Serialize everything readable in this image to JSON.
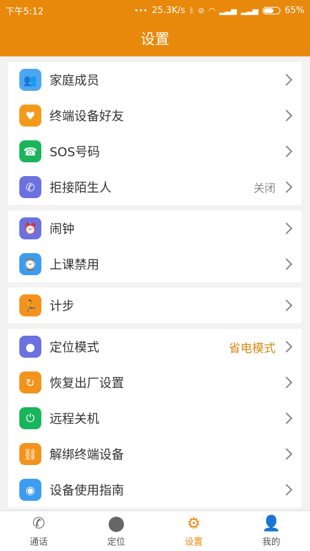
{
  "status_bar": {
    "time": "下午5:12",
    "network_speed": "25.3K/s",
    "battery": "65%",
    "battery_level": 0.65
  },
  "header": {
    "title": "设置"
  },
  "groups": [
    {
      "items": [
        {
          "label": "家庭成员",
          "icon": "family-icon",
          "color": "#4da6f2",
          "value": ""
        },
        {
          "label": "终端设备好友",
          "icon": "device-friend-icon",
          "color": "#f39a1b",
          "value": ""
        },
        {
          "label": "SOS号码",
          "icon": "sos-phone-icon",
          "color": "#19b55b",
          "value": ""
        },
        {
          "label": "拒接陌生人",
          "icon": "reject-call-icon",
          "color": "#6b72e0",
          "value": "关闭"
        }
      ]
    },
    {
      "items": [
        {
          "label": "闹钟",
          "icon": "alarm-icon",
          "color": "#6b72e0",
          "value": ""
        },
        {
          "label": "上课禁用",
          "icon": "class-disable-icon",
          "color": "#3c9df0",
          "value": ""
        }
      ]
    },
    {
      "items": [
        {
          "label": "计步",
          "icon": "step-counter-icon",
          "color": "#f3931b",
          "value": ""
        }
      ]
    },
    {
      "items": [
        {
          "label": "定位模式",
          "icon": "location-mode-icon",
          "color": "#6b72e0",
          "value": "省电模式"
        },
        {
          "label": "恢复出厂设置",
          "icon": "factory-reset-icon",
          "color": "#f3931b",
          "value": ""
        },
        {
          "label": "远程关机",
          "icon": "power-icon",
          "color": "#19b55b",
          "value": ""
        },
        {
          "label": "解绑终端设备",
          "icon": "unbind-icon",
          "color": "#f3931b",
          "value": ""
        },
        {
          "label": "设备使用指南",
          "icon": "guide-icon",
          "color": "#3c9df0",
          "value": ""
        }
      ]
    }
  ],
  "tabbar": {
    "tabs": [
      {
        "label": "通话",
        "icon": "phone-icon"
      },
      {
        "label": "定位",
        "icon": "location-pin-icon"
      },
      {
        "label": "设置",
        "icon": "gear-icon",
        "active": true
      },
      {
        "label": "我的",
        "icon": "profile-icon"
      }
    ]
  },
  "colors": {
    "accent": "#e8890b"
  }
}
